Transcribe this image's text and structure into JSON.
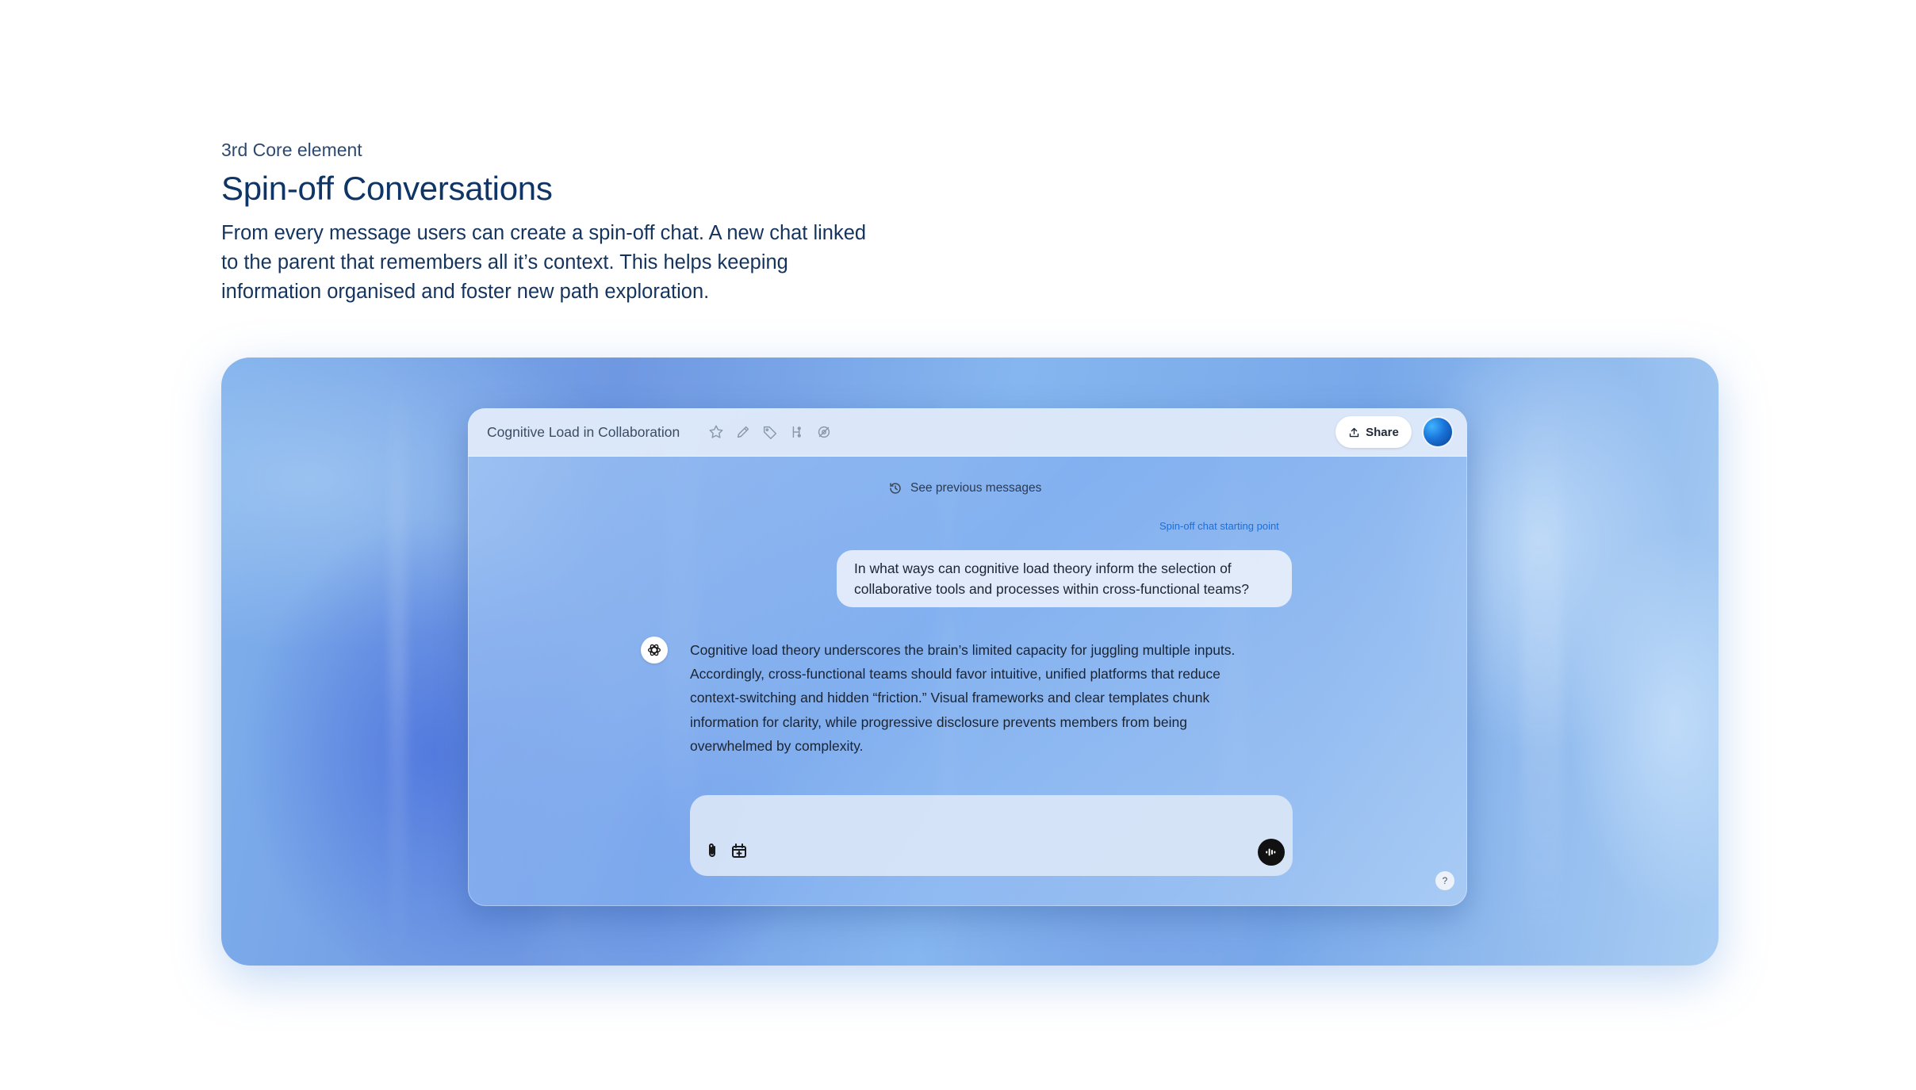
{
  "intro": {
    "eyebrow": "3rd Core element",
    "headline": "Spin-off Conversations",
    "description": "From every message users can create a spin-off chat. A new chat linked to the parent that remembers all it’s context. This helps keeping information organised and foster new path exploration."
  },
  "window": {
    "title": "Cognitive Load in Collaboration",
    "toolbar_icons": [
      "star-icon",
      "pencil-icon",
      "tag-icon",
      "branch-icon",
      "hide-icon"
    ],
    "share_label": "Share",
    "share_icon": "upload-icon",
    "avatar": "user-avatar"
  },
  "chat": {
    "see_previous": "See previous messages",
    "see_previous_icon": "history-icon",
    "spinoff_label": "Spin-off chat starting point",
    "spinoff_color": "#1a6fe0",
    "user_message": "In what ways can cognitive load theory inform the selection of collaborative tools and processes within cross-functional teams?",
    "assistant_icon": "openai-logo-icon",
    "assistant_message": "Cognitive load theory underscores the brain’s limited capacity for juggling multiple inputs. Accordingly, cross-functional teams should favor intuitive, unified platforms that reduce context-switching and hidden “friction.” Visual frameworks and clear templates chunk information for clarity, while progressive disclosure prevents members from being overwhelmed by complexity."
  },
  "composer": {
    "placeholder": "",
    "icons": [
      "paperclip-icon",
      "calendar-plus-icon",
      "voice-icon"
    ]
  },
  "help": {
    "label": "?"
  },
  "colors": {
    "headline": "#0f3566",
    "stage_gradient": [
      "#7fb0ec",
      "#6f98e2",
      "#a9cdf3"
    ]
  }
}
